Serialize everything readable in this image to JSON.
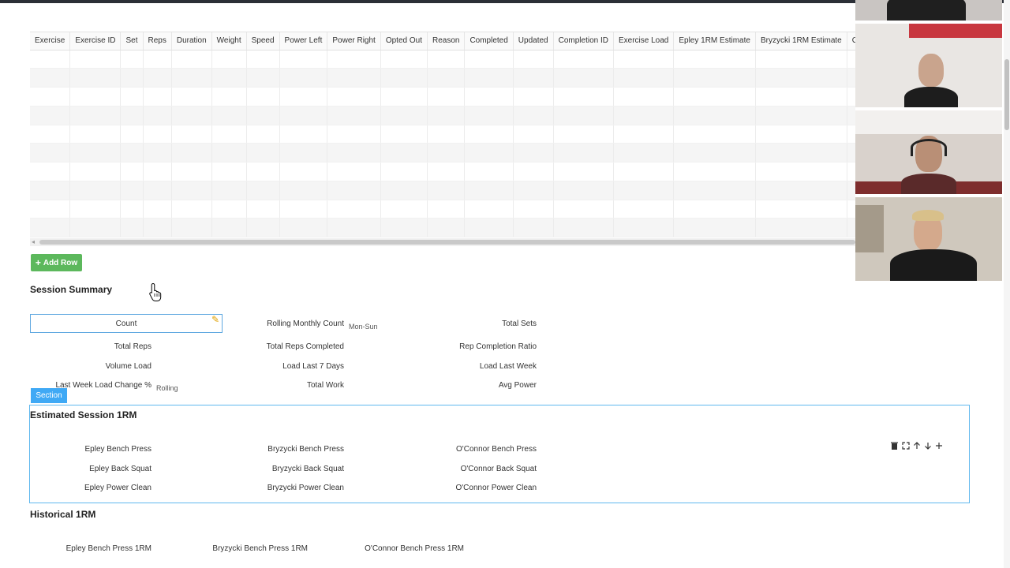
{
  "grid": {
    "columns": [
      "Exercise",
      "Exercise ID",
      "Set",
      "Reps",
      "Duration",
      "Weight",
      "Speed",
      "Power Left",
      "Power Right",
      "Opted Out",
      "Reason",
      "Completed",
      "Updated",
      "Completion ID",
      "Exercise Load",
      "Epley 1RM Estimate",
      "Bryzycki 1RM Estimate",
      "O'C"
    ],
    "row_count": 10
  },
  "buttons": {
    "add_row": "Add Row"
  },
  "session_summary": {
    "title": "Session Summary",
    "count": "Count",
    "rolling_monthly_count": "Rolling Monthly Count",
    "rolling_monthly_sub": "Mon-Sun",
    "total_sets": "Total Sets",
    "total_reps": "Total Reps",
    "total_reps_completed": "Total Reps Completed",
    "rep_completion_ratio": "Rep Completion Ratio",
    "volume_load": "Volume Load",
    "load_last_7_days": "Load Last 7 Days",
    "load_last_week": "Load Last Week",
    "last_week_load_change": "Last Week Load Change %",
    "last_week_load_change_sub": "Rolling",
    "total_work": "Total Work",
    "avg_power": "Avg Power"
  },
  "section": {
    "tag": "Section",
    "title": "Estimated Session 1RM",
    "items": {
      "epley_bench": "Epley Bench Press",
      "bryzycki_bench": "Bryzycki Bench Press",
      "oconnor_bench": "O'Connor Bench Press",
      "epley_squat": "Epley Back Squat",
      "bryzycki_squat": "Bryzycki Back Squat",
      "oconnor_squat": "O'Connor Back Squat",
      "epley_clean": "Epley Power Clean",
      "bryzycki_clean": "Bryzycki Power Clean",
      "oconnor_clean": "O'Connor Power Clean"
    }
  },
  "historical": {
    "title": "Historical 1RM",
    "epley_bench": "Epley Bench Press 1RM",
    "bryzycki_bench": "Bryzycki Bench Press 1RM",
    "oconnor_bench": "O'Connor Bench Press 1RM"
  },
  "icons": {
    "plus": "plus-icon",
    "pencil": "pencil-icon",
    "trash": "trash-icon",
    "expand": "expand-icon",
    "up": "arrow-up-icon",
    "down": "arrow-down-icon",
    "add": "plus-icon"
  },
  "colors": {
    "accent_green": "#5cb85c",
    "section_blue": "#3fa9f5",
    "section_border": "#5fb8ee"
  }
}
